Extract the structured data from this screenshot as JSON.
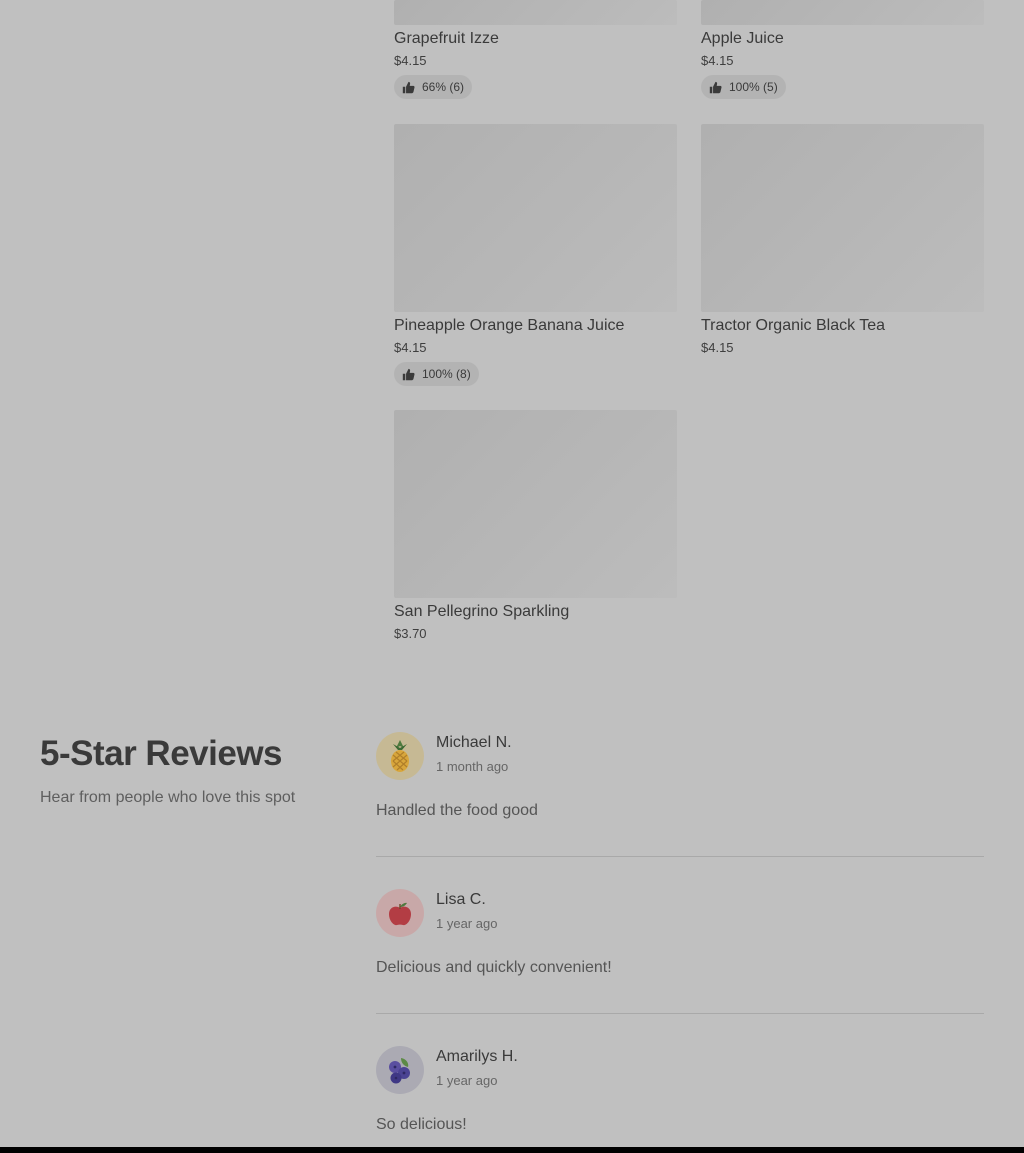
{
  "products": [
    {
      "name": "Grapefruit Izze",
      "price": "$4.15",
      "rating": "66% (6)"
    },
    {
      "name": "Apple Juice",
      "price": "$4.15",
      "rating": "100% (5)"
    },
    {
      "name": "Pineapple Orange Banana Juice",
      "price": "$4.15",
      "rating": "100% (8)"
    },
    {
      "name": "Tractor Organic Black Tea",
      "price": "$4.15"
    },
    {
      "name": "San Pellegrino Sparkling",
      "price": "$3.70"
    }
  ],
  "reviews_section": {
    "title": "5-Star Reviews",
    "subtitle": "Hear from people who love this spot",
    "reviews": [
      {
        "name": "Michael N.",
        "time": "1 month ago",
        "text": "Handled the food good",
        "avatar_icon": "pineapple-icon"
      },
      {
        "name": "Lisa C.",
        "time": "1 year ago",
        "text": "Delicious and quickly convenient!",
        "avatar_icon": "apple-icon"
      },
      {
        "name": "Amarilys H.",
        "time": "1 year ago",
        "text": "So delicious!",
        "avatar_icon": "blueberry-icon"
      }
    ]
  },
  "colors": {
    "overlay_background": "#c0c0c0",
    "rating_pill": "#b3b3b3",
    "avatar_pineapple_bg": "#c6b994",
    "avatar_apple_bg": "#c8a8a8",
    "avatar_blueberry_bg": "#abaab3"
  }
}
